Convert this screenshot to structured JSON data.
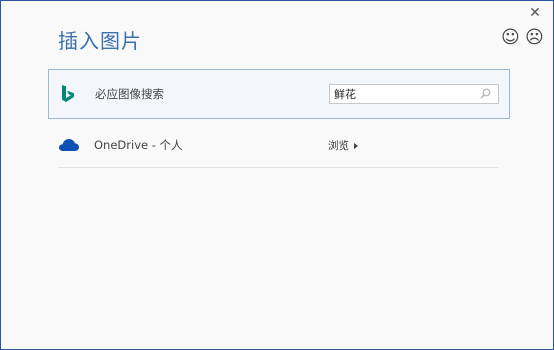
{
  "dialog": {
    "title": "插入图片",
    "close_glyph": "✕",
    "feedback": {
      "happy_glyph": "☺",
      "sad_glyph": "☹"
    }
  },
  "bing_search": {
    "label": "必应图像搜索",
    "query_value": "鲜花",
    "icon": "bing-icon",
    "search_icon": "search-icon",
    "accent_color": "#00897b"
  },
  "onedrive": {
    "label": "OneDrive - 个人",
    "browse_label": "浏览",
    "icon": "cloud-icon",
    "accent_color": "#0d4fb3"
  },
  "colors": {
    "title": "#3b6fb0",
    "border": "#2b579a"
  }
}
